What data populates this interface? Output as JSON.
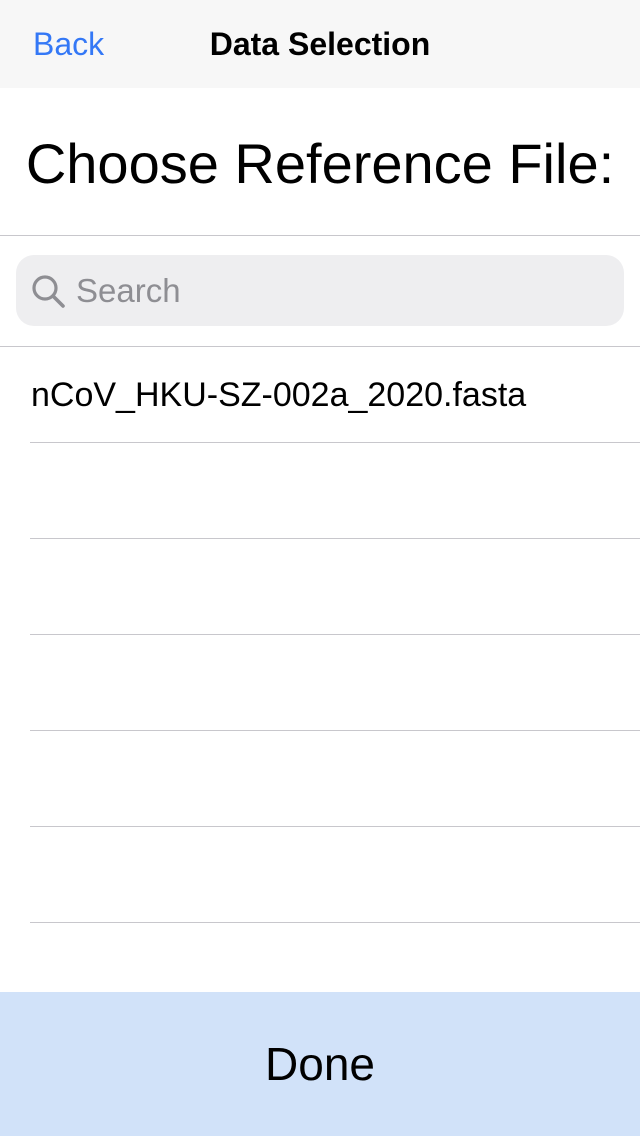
{
  "navbar": {
    "back_label": "Back",
    "title": "Data Selection"
  },
  "heading": "Choose Reference File:",
  "search": {
    "placeholder": "Search",
    "value": "",
    "icon": "search-icon"
  },
  "files": [
    {
      "label": "nCoV_HKU-SZ-002a_2020.fasta"
    },
    {
      "label": ""
    },
    {
      "label": ""
    },
    {
      "label": ""
    },
    {
      "label": ""
    },
    {
      "label": ""
    },
    {
      "label": ""
    }
  ],
  "done_label": "Done",
  "colors": {
    "accent": "#3478f6",
    "navbar_bg": "#f7f7f7",
    "done_bg": "#d1e2f9",
    "search_bg": "#eeeef0",
    "separator": "#c8c7cc"
  }
}
